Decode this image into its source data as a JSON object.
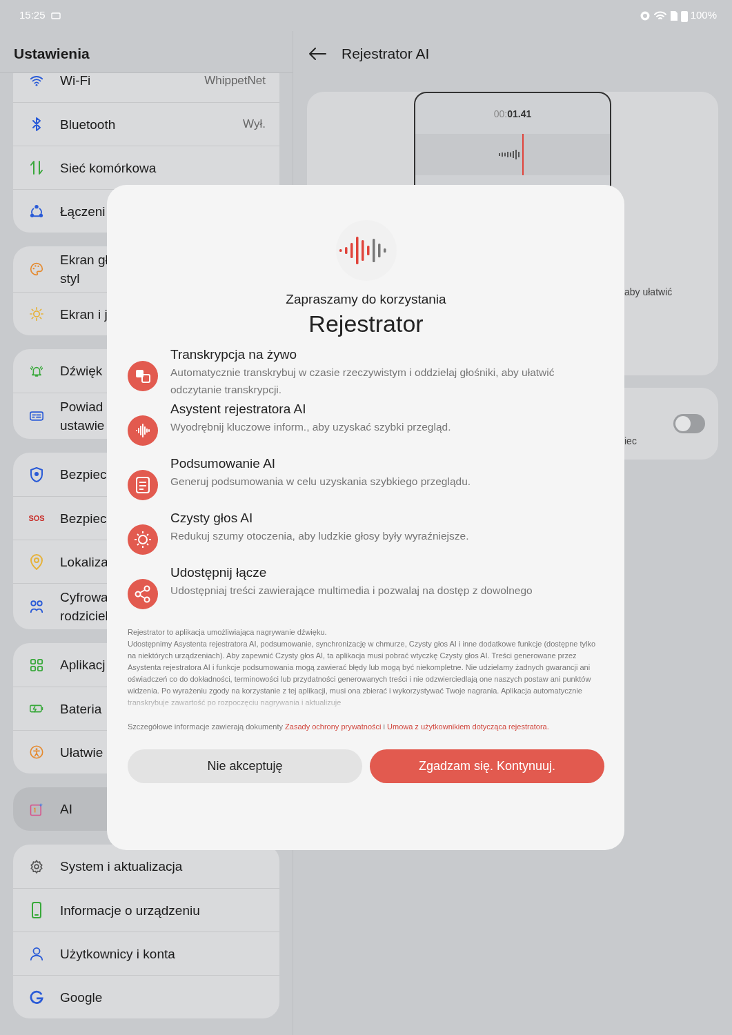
{
  "status_bar": {
    "time": "15:25",
    "battery": "100%"
  },
  "settings": {
    "title": "Ustawienia",
    "groups": [
      {
        "items": [
          {
            "lines": [
              "Wi-Fi"
            ],
            "value": "WhippetNet",
            "selected": false
          },
          {
            "lines": [
              "Bluetooth"
            ],
            "value": "Wył.",
            "selected": false
          },
          {
            "lines": [
              "Sieć komórkowa"
            ],
            "selected": false
          },
          {
            "lines": [
              "Łączeni"
            ],
            "selected": false
          }
        ]
      },
      {
        "items": [
          {
            "lines": [
              "Ekran gł",
              "styl"
            ],
            "selected": false
          },
          {
            "lines": [
              "Ekran i j"
            ],
            "selected": false
          }
        ]
      },
      {
        "items": [
          {
            "lines": [
              "Dźwięk"
            ],
            "selected": false
          },
          {
            "lines": [
              "Powiad",
              "ustawie"
            ],
            "selected": false
          }
        ]
      },
      {
        "items": [
          {
            "lines": [
              "Bezpiec"
            ],
            "selected": false
          },
          {
            "lines": [
              "Bezpiec"
            ],
            "badge": "SOS",
            "selected": false
          },
          {
            "lines": [
              "Lokaliza"
            ],
            "selected": false
          },
          {
            "lines": [
              "Cyfrowa",
              "rodziciel"
            ],
            "selected": false
          }
        ]
      },
      {
        "items": [
          {
            "lines": [
              "Aplikacj"
            ],
            "selected": false
          },
          {
            "lines": [
              "Bateria"
            ],
            "selected": false
          },
          {
            "lines": [
              "Ułatwie"
            ],
            "selected": false
          }
        ]
      },
      {
        "items": [
          {
            "lines": [
              "AI"
            ],
            "selected": true
          }
        ]
      },
      {
        "items": [
          {
            "lines": [
              "System i aktualizacja"
            ],
            "selected": false
          },
          {
            "lines": [
              "Informacje o urządzeniu"
            ],
            "selected": false
          },
          {
            "lines": [
              "Użytkownicy i konta"
            ],
            "selected": false
          },
          {
            "lines": [
              "Google"
            ],
            "selected": false
          }
        ]
      }
    ]
  },
  "detail": {
    "title": "Rejestrator AI",
    "preview": {
      "timer_dim": "00:",
      "timer": "01.41"
    },
    "fragment_1": "aby ułatwić",
    "fragment_2": "iec",
    "toggle": {
      "on": false
    }
  },
  "dialog": {
    "subtitle": "Zapraszamy do korzystania",
    "title": "Rejestrator",
    "features": [
      {
        "title": "Transkrypcja na żywo",
        "desc": "Automatycznie transkrybuj w czasie rzeczywistym i oddzielaj głośniki, aby ułatwić odczytanie transkrypcji."
      },
      {
        "title": "Asystent rejestratora AI",
        "desc": "Wyodrębnij kluczowe inform., aby uzyskać szybki przegląd."
      },
      {
        "title": "Podsumowanie AI",
        "desc": "Generuj podsumowania w celu uzyskania szybkiego przeglądu."
      },
      {
        "title": "Czysty głos AI",
        "desc": "Redukuj szumy otoczenia, aby ludzkie głosy były wyraźniejsze."
      },
      {
        "title": "Udostępnij łącze",
        "desc": "Udostępniaj treści zawierające multimedia i pozwalaj na dostęp z dowolnego"
      }
    ],
    "disclaimer": [
      "Rejestrator to aplikacja umożliwiająca nagrywanie dźwięku.",
      "Udostępnimy Asystenta rejestratora AI, podsumowanie, synchronizację w chmurze, Czysty głos AI i inne dodatkowe funkcje (dostępne tylko na niektórych urządzeniach). Aby zapewnić Czysty głos AI, ta aplikacja musi pobrać wtyczkę Czysty głos AI. Treści generowane przez Asystenta rejestratora AI i funkcje podsumowania mogą zawierać błędy lub mogą być niekompletne. Nie udzielamy żadnych gwarancji ani oświadczeń co do dokładności, terminowości lub przydatności generowanych treści i nie odzwierciedlają one naszych postaw ani punktów widzenia. Po wyrażeniu zgody na korzystanie z tej aplikacji, musi ona zbierać i wykorzystywać Twoje nagrania. Aplikacja automatycznie transkrybuje zawartość po rozpoczęciu nagrywania i aktualizuje"
    ],
    "details": {
      "text": "Szczegółowe informacje zawierają dokumenty",
      "links": [
        "Zasady ochrony prywatności",
        "Umowa z użytkownikiem dotycząca rejestratora."
      ],
      "joiner": "i"
    },
    "buttons": [
      {
        "label": "Nie akceptuję",
        "kind": "secondary"
      },
      {
        "label": "Zgadzam się. Kontynuuj.",
        "kind": "primary"
      }
    ]
  }
}
